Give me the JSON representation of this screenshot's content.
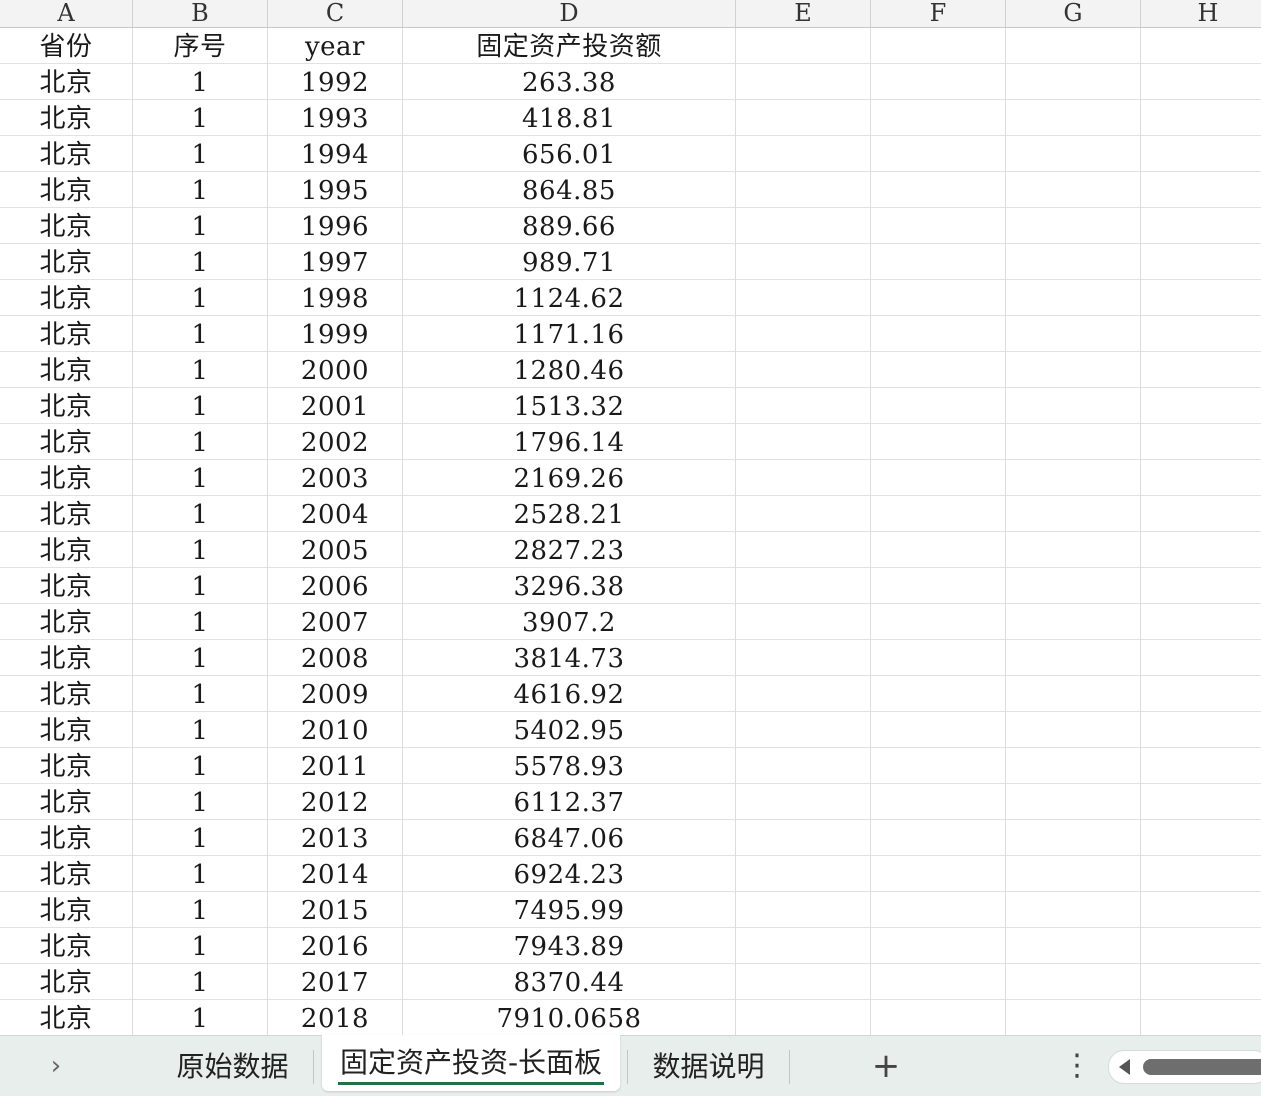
{
  "columns": [
    "A",
    "B",
    "C",
    "D",
    "E",
    "F",
    "G",
    "H"
  ],
  "header_row": [
    "省份",
    "序号",
    "year",
    "固定资产投资额"
  ],
  "rows": [
    [
      "北京",
      "1",
      "1992",
      "263.38"
    ],
    [
      "北京",
      "1",
      "1993",
      "418.81"
    ],
    [
      "北京",
      "1",
      "1994",
      "656.01"
    ],
    [
      "北京",
      "1",
      "1995",
      "864.85"
    ],
    [
      "北京",
      "1",
      "1996",
      "889.66"
    ],
    [
      "北京",
      "1",
      "1997",
      "989.71"
    ],
    [
      "北京",
      "1",
      "1998",
      "1124.62"
    ],
    [
      "北京",
      "1",
      "1999",
      "1171.16"
    ],
    [
      "北京",
      "1",
      "2000",
      "1280.46"
    ],
    [
      "北京",
      "1",
      "2001",
      "1513.32"
    ],
    [
      "北京",
      "1",
      "2002",
      "1796.14"
    ],
    [
      "北京",
      "1",
      "2003",
      "2169.26"
    ],
    [
      "北京",
      "1",
      "2004",
      "2528.21"
    ],
    [
      "北京",
      "1",
      "2005",
      "2827.23"
    ],
    [
      "北京",
      "1",
      "2006",
      "3296.38"
    ],
    [
      "北京",
      "1",
      "2007",
      "3907.2"
    ],
    [
      "北京",
      "1",
      "2008",
      "3814.73"
    ],
    [
      "北京",
      "1",
      "2009",
      "4616.92"
    ],
    [
      "北京",
      "1",
      "2010",
      "5402.95"
    ],
    [
      "北京",
      "1",
      "2011",
      "5578.93"
    ],
    [
      "北京",
      "1",
      "2012",
      "6112.37"
    ],
    [
      "北京",
      "1",
      "2013",
      "6847.06"
    ],
    [
      "北京",
      "1",
      "2014",
      "6924.23"
    ],
    [
      "北京",
      "1",
      "2015",
      "7495.99"
    ],
    [
      "北京",
      "1",
      "2016",
      "7943.89"
    ],
    [
      "北京",
      "1",
      "2017",
      "8370.44"
    ],
    [
      "北京",
      "1",
      "2018",
      "7910.0658"
    ]
  ],
  "tabs": {
    "nav_icon": "chevron-right-icon",
    "nav_glyph": "›",
    "items": [
      "原始数据",
      "固定资产投资-长面板",
      "数据说明"
    ],
    "active_index": 1,
    "active_color": "#1e7145",
    "add_glyph": "+",
    "more_glyph": "⋮"
  }
}
